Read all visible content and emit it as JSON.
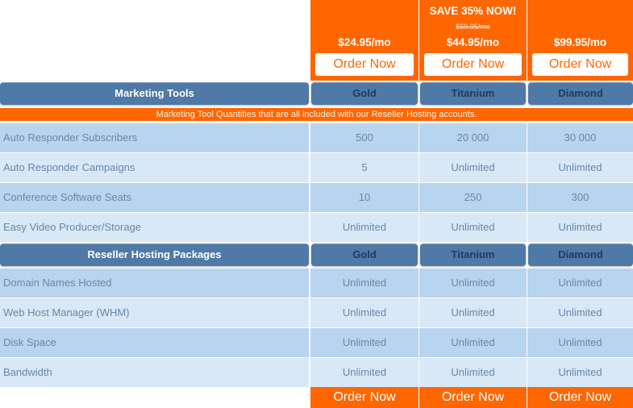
{
  "plans": {
    "gold": {
      "price": "$24.95/mo",
      "order": "Order Now"
    },
    "titanium": {
      "promo": "SAVE 35% NOW!",
      "old_price": "$69.95/mo",
      "price": "$44.95/mo",
      "order": "Order Now"
    },
    "diamond": {
      "price": "$99.95/mo",
      "order": "Order Now"
    }
  },
  "marketing": {
    "title": "Marketing Tools",
    "cols": [
      "Gold",
      "Titanium",
      "Diamond"
    ],
    "banner": "Marketing Tool Quantities that are all included with our Reseller Hosting accounts.",
    "rows": [
      {
        "label": "Auto Responder Subscribers",
        "values": [
          "500",
          "20 000",
          "30 000"
        ]
      },
      {
        "label": "Auto Responder Campaigns",
        "values": [
          "5",
          "Unlimited",
          "Unlimited"
        ]
      },
      {
        "label": "Conference Software Seats",
        "values": [
          "10",
          "250",
          "300"
        ]
      },
      {
        "label": "Easy Video Producer/Storage",
        "values": [
          "Unlimited",
          "Unlimited",
          "Unlimited"
        ]
      }
    ]
  },
  "hosting": {
    "title": "Reseller Hosting Packages",
    "cols": [
      "Gold",
      "Titanium",
      "Diamond"
    ],
    "rows": [
      {
        "label": "Domain Names Hosted",
        "values": [
          "Unlimited",
          "Unlimited",
          "Unlimited"
        ]
      },
      {
        "label": "Web Host Manager (WHM)",
        "values": [
          "Unlimited",
          "Unlimited",
          "Unlimited"
        ]
      },
      {
        "label": "Disk Space",
        "values": [
          "Unlimited",
          "Unlimited",
          "Unlimited"
        ]
      },
      {
        "label": "Bandwidth",
        "values": [
          "Unlimited",
          "Unlimited",
          "Unlimited"
        ]
      }
    ]
  },
  "footer": {
    "order_labels": [
      "Order Now",
      "Order Now",
      "Order Now"
    ]
  },
  "colors": {
    "accent": "#ff6600",
    "header": "#4f79a6",
    "row_dark": "#b8d4ee",
    "row_light": "#d8e8f7"
  }
}
